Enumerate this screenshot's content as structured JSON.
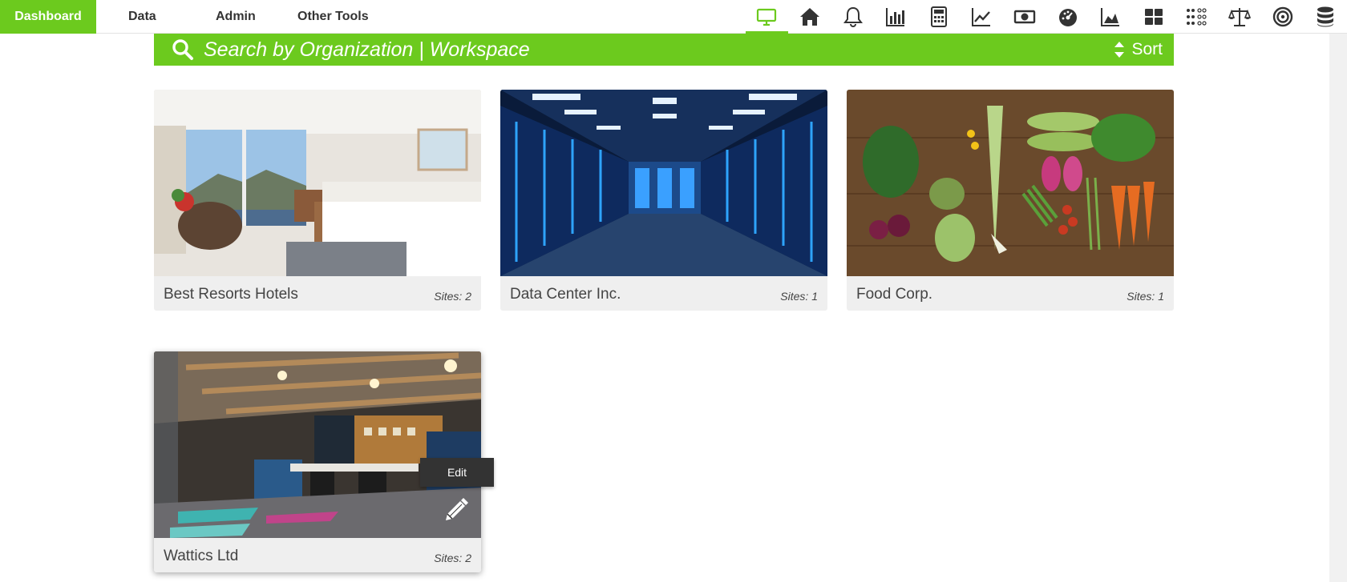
{
  "nav": {
    "brand": "Dashboard",
    "links": [
      "Data",
      "Admin",
      "Other Tools"
    ],
    "icons": [
      "monitor-icon",
      "home-icon",
      "bell-icon",
      "bar-chart-icon",
      "calculator-icon",
      "line-chart-icon",
      "money-icon",
      "gauge-icon",
      "area-chart-icon",
      "grid-icon",
      "dots-icon",
      "balance-scale-icon",
      "target-icon",
      "database-icon"
    ],
    "accent": "#6cca1e"
  },
  "search": {
    "placeholder": "Search by Organization | Workspace",
    "sort_label": "Sort"
  },
  "cards": [
    {
      "title": "Best Resorts Hotels",
      "sites": "Sites: 2",
      "image": "hotel-room"
    },
    {
      "title": "Data Center Inc.",
      "sites": "Sites: 1",
      "image": "server-room"
    },
    {
      "title": "Food Corp.",
      "sites": "Sites: 1",
      "image": "vegetables"
    },
    {
      "title": "Wattics Ltd",
      "sites": "Sites: 2",
      "image": "office"
    }
  ],
  "tooltip": {
    "label": "Edit"
  }
}
